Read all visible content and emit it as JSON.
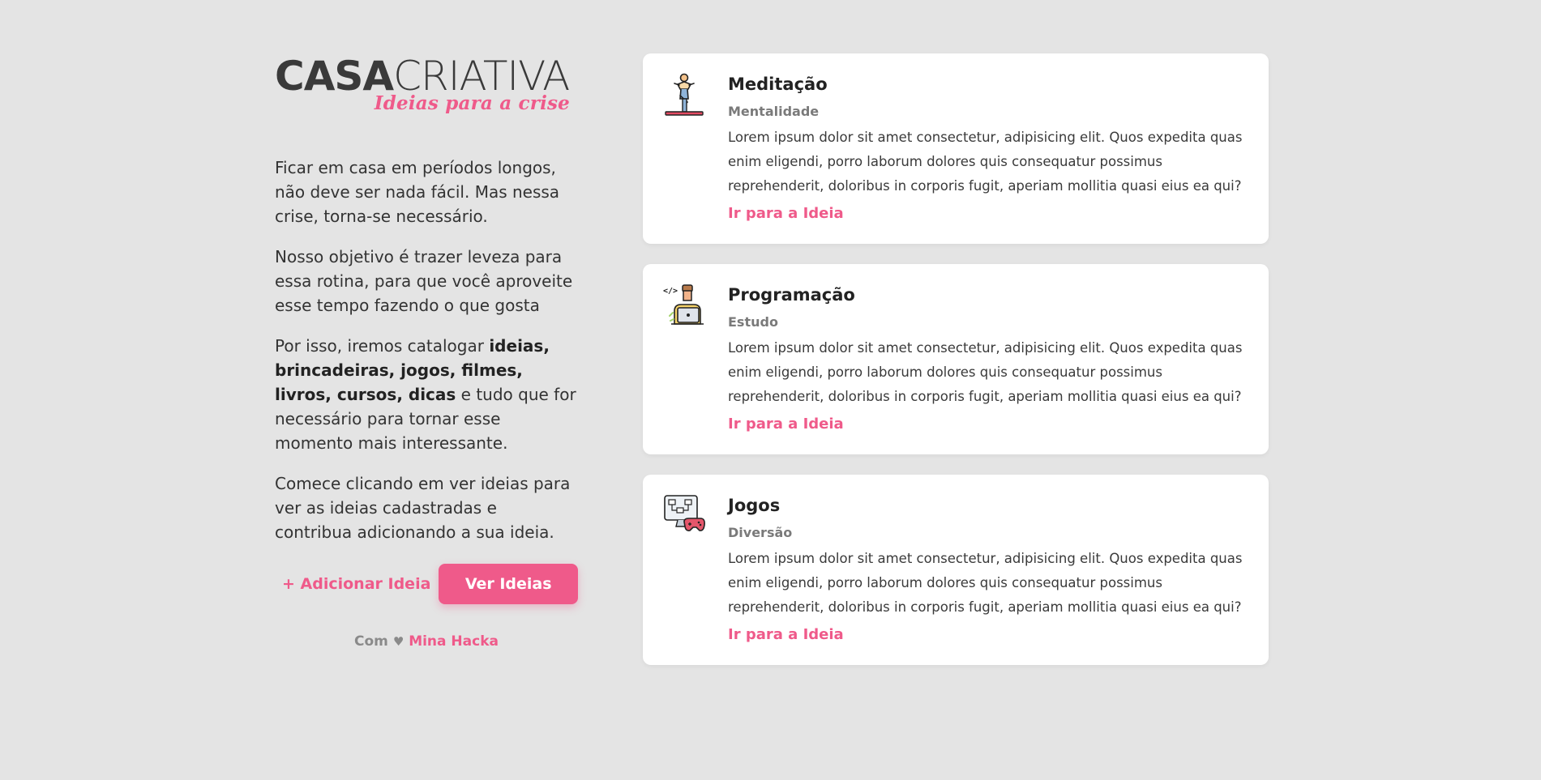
{
  "brand": {
    "name_part1": "CASA",
    "name_part2": "CRIATIVA",
    "tagline": "Ideias para a crise",
    "accent_color": "#ef5a8a"
  },
  "intro": {
    "p1": "Ficar em casa em períodos longos, não deve ser nada fácil. Mas nessa crise, torna-se necessário.",
    "p2": "Nosso objetivo é trazer leveza para essa rotina, para que você aproveite esse tempo fazendo o que gosta",
    "p3_before": "Por isso, iremos catalogar ",
    "p3_bold": "ideias, brincadeiras, jogos, filmes, livros, cursos, dicas",
    "p3_after": " e tudo que for necessário para tornar esse momento mais interessante.",
    "p4": "Comece clicando em ver ideias para ver as ideias cadastradas e contribua adicionando a sua ideia."
  },
  "actions": {
    "add_label": "+ Adicionar Ideia",
    "view_label": "Ver Ideias"
  },
  "credit": {
    "prefix": "Com",
    "heart": "♥",
    "author": "Mina Hacka"
  },
  "cards": [
    {
      "icon": "meditation-icon",
      "title": "Meditação",
      "category": "Mentalidade",
      "description": "Lorem ipsum dolor sit amet consectetur, adipisicing elit. Quos expedita quas enim eligendi, porro laborum dolores quis consequatur possimus reprehenderit, doloribus in corporis fugit, aperiam mollitia quasi eius ea qui?",
      "link": "Ir para a Ideia"
    },
    {
      "icon": "programmer-icon",
      "title": "Programação",
      "category": "Estudo",
      "description": "Lorem ipsum dolor sit amet consectetur, adipisicing elit. Quos expedita quas enim eligendi, porro laborum dolores quis consequatur possimus reprehenderit, doloribus in corporis fugit, aperiam mollitia quasi eius ea qui?",
      "link": "Ir para a Ideia"
    },
    {
      "icon": "game-monitor-icon",
      "title": "Jogos",
      "category": "Diversão",
      "description": "Lorem ipsum dolor sit amet consectetur, adipisicing elit. Quos expedita quas enim eligendi, porro laborum dolores quis consequatur possimus reprehenderit, doloribus in corporis fugit, aperiam mollitia quasi eius ea qui?",
      "link": "Ir para a Ideia"
    }
  ]
}
